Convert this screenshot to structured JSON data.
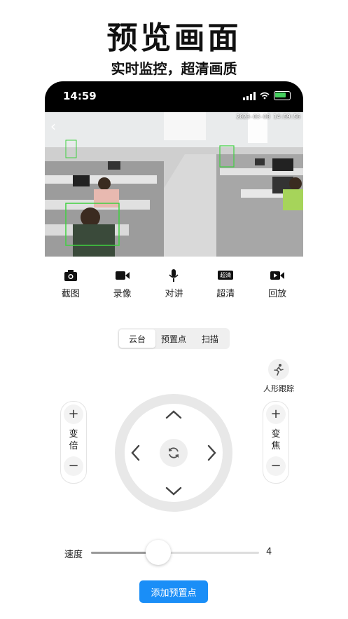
{
  "headline": "预览画面",
  "subline": "实时监控，超清画质",
  "status_bar": {
    "time": "14:59"
  },
  "video": {
    "timestamp": "2023-03-08 14:59:56"
  },
  "toolbar": {
    "items": [
      {
        "label": "截图",
        "icon": "camera-icon"
      },
      {
        "label": "录像",
        "icon": "video-camera-icon"
      },
      {
        "label": "对讲",
        "icon": "microphone-icon"
      },
      {
        "label": "超清",
        "icon": "hd-badge-icon",
        "badge": "超清"
      },
      {
        "label": "回放",
        "icon": "playback-icon"
      }
    ]
  },
  "tabs": [
    {
      "label": "云台",
      "active": true
    },
    {
      "label": "预置点",
      "active": false
    },
    {
      "label": "扫描",
      "active": false
    }
  ],
  "track": {
    "label": "人形跟踪"
  },
  "zoom": {
    "label": "变倍",
    "plus": "+",
    "minus": "−"
  },
  "focus": {
    "label": "变焦",
    "plus": "+",
    "minus": "−"
  },
  "speed": {
    "label": "速度",
    "value": "4",
    "max": 10
  },
  "add_preset": {
    "label": "添加预置点"
  },
  "colors": {
    "accent": "#1a8ef7",
    "status_bar": "#000000"
  }
}
